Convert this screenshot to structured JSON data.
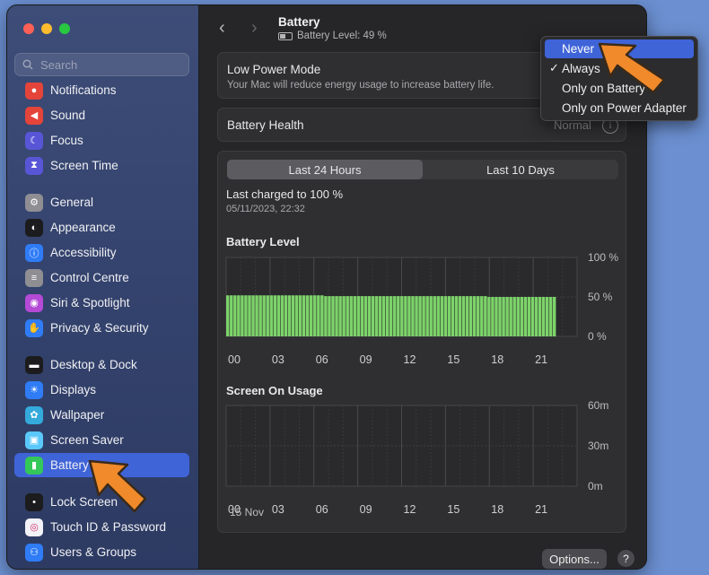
{
  "window": {
    "traffic_lights": [
      "#fe5f57",
      "#febc2e",
      "#28c840"
    ]
  },
  "search": {
    "placeholder": "Search"
  },
  "sidebar": {
    "items": [
      {
        "label": "Notifications",
        "icon": "bell-icon",
        "color": "#e4443a"
      },
      {
        "label": "Sound",
        "icon": "speaker-icon",
        "color": "#e4443a"
      },
      {
        "label": "Focus",
        "icon": "moon-icon",
        "color": "#5856d6"
      },
      {
        "label": "Screen Time",
        "icon": "hourglass-icon",
        "color": "#5856d6"
      },
      {
        "label": "General",
        "icon": "gear-icon",
        "color": "#8e8e93"
      },
      {
        "label": "Appearance",
        "icon": "appearance-icon",
        "color": "#1c1c1e"
      },
      {
        "label": "Accessibility",
        "icon": "accessibility-icon",
        "color": "#2f7cf6"
      },
      {
        "label": "Control Centre",
        "icon": "toggles-icon",
        "color": "#8e8e93"
      },
      {
        "label": "Siri & Spotlight",
        "icon": "siri-icon",
        "color": "#b44ad6"
      },
      {
        "label": "Privacy & Security",
        "icon": "hand-icon",
        "color": "#2f7cf6"
      },
      {
        "label": "Desktop & Dock",
        "icon": "dock-icon",
        "color": "#1c1c1e"
      },
      {
        "label": "Displays",
        "icon": "sun-icon",
        "color": "#2f7cf6"
      },
      {
        "label": "Wallpaper",
        "icon": "flower-icon",
        "color": "#34aadc"
      },
      {
        "label": "Screen Saver",
        "icon": "screensaver-icon",
        "color": "#5ac8fa"
      },
      {
        "label": "Battery",
        "icon": "battery-icon",
        "color": "#34c759"
      },
      {
        "label": "Lock Screen",
        "icon": "lock-icon",
        "color": "#1c1c1e"
      },
      {
        "label": "Touch ID & Password",
        "icon": "fingerprint-icon",
        "color": "#f2f2f7"
      },
      {
        "label": "Users & Groups",
        "icon": "users-icon",
        "color": "#2f7cf6"
      }
    ]
  },
  "header": {
    "title": "Battery",
    "subtitle": "Battery Level: 49 %"
  },
  "low_power": {
    "title": "Low Power Mode",
    "description": "Your Mac will reduce energy usage to increase battery life.",
    "selected": "Always"
  },
  "battery_health": {
    "label": "Battery Health",
    "value": "Normal"
  },
  "tabs": {
    "tab1": "Last 24 Hours",
    "tab2": "Last 10 Days"
  },
  "last_charged": {
    "label": "Last charged to 100 %",
    "date": "05/11/2023, 22:32"
  },
  "chart_data": [
    {
      "type": "bar",
      "title": "Battery Level",
      "ylim": [
        0,
        100
      ],
      "y_ticks": [
        "100 %",
        "50 %",
        "0 %"
      ],
      "x_ticks": [
        "00",
        "03",
        "06",
        "09",
        "12",
        "15",
        "18",
        "21"
      ],
      "values": [
        52,
        52,
        52,
        52,
        52,
        52,
        52,
        52,
        52,
        52,
        52,
        52,
        52,
        52,
        52,
        52,
        52,
        52,
        52,
        52,
        52,
        52,
        52,
        52,
        52,
        52,
        52,
        51,
        51,
        51,
        51,
        51,
        51,
        51,
        51,
        51,
        51,
        51,
        51,
        51,
        51,
        51,
        51,
        51,
        51,
        51,
        51,
        51,
        51,
        51,
        51,
        51,
        51,
        51,
        51,
        51,
        51,
        51,
        51,
        51,
        51,
        51,
        51,
        51,
        51,
        51,
        51,
        51,
        51,
        51,
        51,
        51,
        50,
        50,
        50,
        50,
        50,
        50,
        50,
        50,
        50,
        50,
        50,
        50,
        50,
        50,
        50,
        50,
        50,
        50,
        50
      ],
      "bar_color": "#7dd36a"
    },
    {
      "type": "bar",
      "title": "Screen On Usage",
      "y_ticks": [
        "60m",
        "30m",
        "0m"
      ],
      "x_ticks": [
        "00",
        "03",
        "06",
        "09",
        "12",
        "15",
        "18",
        "21"
      ],
      "date_label": "15 Nov",
      "values": []
    }
  ],
  "footer": {
    "options_label": "Options...",
    "help_label": "?"
  },
  "dropdown": {
    "options": [
      "Never",
      "Always",
      "Only on Battery",
      "Only on Power Adapter"
    ],
    "highlighted": "Never",
    "checked": "Always"
  }
}
